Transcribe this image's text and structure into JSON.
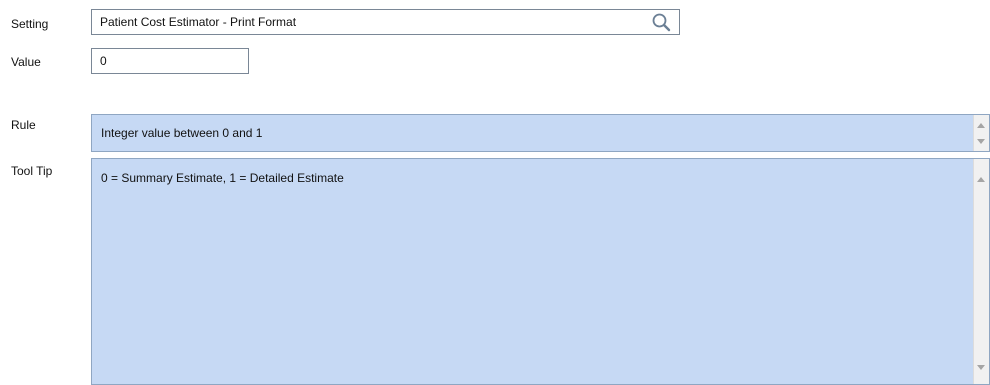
{
  "form": {
    "setting_label": "Setting",
    "setting_value": "Patient Cost Estimator - Print Format",
    "value_label": "Value",
    "value_value": "0",
    "rule_label": "Rule",
    "rule_value": "Integer value between 0 and 1",
    "tooltip_label": "Tool Tip",
    "tooltip_value": "0 = Summary Estimate, 1 = Detailed Estimate"
  },
  "icons": {
    "search": "search-icon"
  },
  "colors": {
    "readonly_background": "#c6d9f4",
    "field_border": "#7a8796"
  }
}
